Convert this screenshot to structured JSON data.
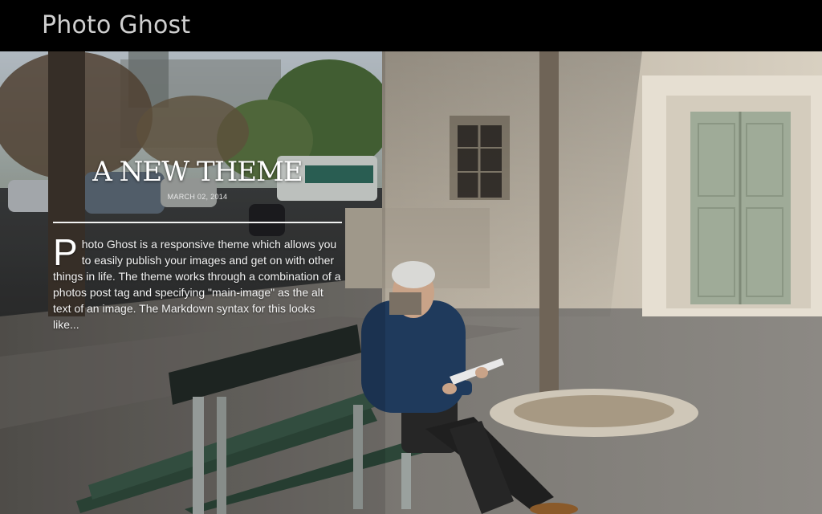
{
  "site": {
    "title": "Photo Ghost"
  },
  "post": {
    "title": "A NEW THEME",
    "date": "MARCH 02, 2014",
    "excerpt_dropcap": "P",
    "excerpt_rest": "hoto Ghost is a responsive theme which allows you to easily publish your images and get on with other things in life. The theme works through a combination of a photos post tag and specifying \"main-image\" as the alt text of an image. The Markdown syntax for this looks like..."
  },
  "colors": {
    "topbar": "#000000",
    "title_text": "#cfcfcf",
    "post_text": "#ffffff"
  },
  "hero_image": {
    "icon": "street-photo-man-on-bench"
  }
}
